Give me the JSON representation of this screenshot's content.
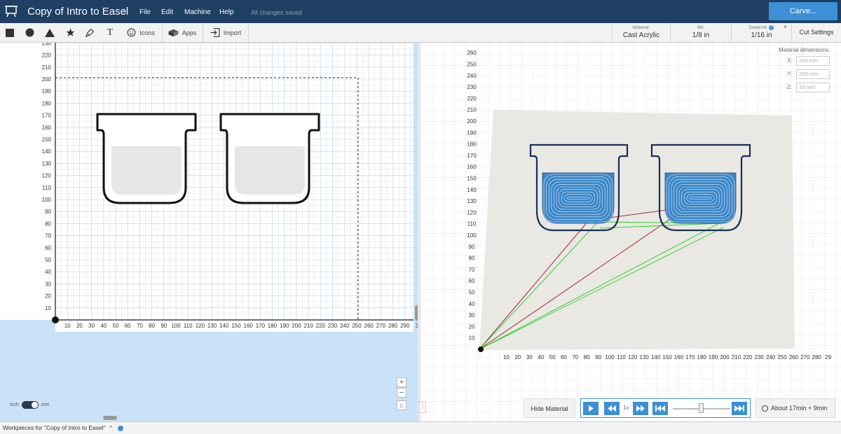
{
  "header": {
    "title": "Copy of Intro to Easel",
    "menu": [
      "File",
      "Edit",
      "Machine",
      "Help"
    ],
    "save_status": "All changes saved",
    "carve_label": "Carve..."
  },
  "toolbar": {
    "shape_tools": [
      "square-icon",
      "circle-icon",
      "triangle-icon",
      "star-icon",
      "pen-icon",
      "text-icon"
    ],
    "icons_label": "Icons",
    "apps_label": "Apps",
    "import_label": "Import",
    "material_caption": "Material:",
    "material_value": "Cast Acrylic",
    "bit_caption": "Bit:",
    "bit_value": "1/8 in",
    "detail_bit_caption": "Detail bit:",
    "detail_bit_value": "1/16 in",
    "cut_settings_label": "Cut Settings"
  },
  "design_canvas": {
    "y_ticks": [
      "10",
      "20",
      "30",
      "40",
      "50",
      "60",
      "70",
      "80",
      "90",
      "100",
      "110",
      "120",
      "130",
      "140",
      "150",
      "160",
      "170",
      "180",
      "190",
      "200",
      "210",
      "220",
      "230"
    ],
    "x_ticks": [
      "10",
      "20",
      "30",
      "40",
      "50",
      "60",
      "70",
      "80",
      "90",
      "100",
      "110",
      "120",
      "130",
      "140",
      "150",
      "160",
      "170",
      "180",
      "190",
      "200",
      "210",
      "220",
      "230",
      "240",
      "250",
      "260",
      "270",
      "280",
      "290",
      "3"
    ],
    "unit_inch": "inch",
    "unit_mm": "mm",
    "unit_selected": "mm",
    "zoom_in": "+",
    "zoom_out": "−"
  },
  "preview": {
    "y_ticks": [
      "10",
      "20",
      "30",
      "40",
      "50",
      "60",
      "70",
      "80",
      "90",
      "100",
      "110",
      "120",
      "130",
      "140",
      "150",
      "160",
      "170",
      "180",
      "190",
      "200",
      "210",
      "220",
      "230",
      "240",
      "250",
      "260"
    ],
    "x_ticks": [
      "10",
      "20",
      "30",
      "40",
      "50",
      "60",
      "70",
      "80",
      "90",
      "100",
      "110",
      "120",
      "130",
      "140",
      "150",
      "160",
      "170",
      "180",
      "190",
      "200",
      "210",
      "220",
      "230",
      "240",
      "250",
      "260",
      "270",
      "280",
      "29"
    ],
    "material_dimensions_label": "Material dimensions:",
    "dims": [
      {
        "axis": "X:",
        "value": "250 mm"
      },
      {
        "axis": "Y:",
        "value": "200 mm"
      },
      {
        "axis": "Z:",
        "value": "10 mm"
      }
    ],
    "close_label": "×"
  },
  "playback": {
    "hide_material_label": "Hide Material",
    "speed_label": "1x",
    "time_estimate": "About 17min + 9min",
    "menu_dots": "⋮"
  },
  "colors": {
    "header_bg": "#1f3f63",
    "accent": "#3d8fd6",
    "canvas_bg": "#c9e2f7",
    "toolpath_fill": "#3a86c8",
    "rapid_red": "#a0283c",
    "rapid_green": "#33cc33"
  },
  "status_bar": {
    "text": "Workpieces for \"Copy of Intro to Easel\"",
    "caret": "^"
  }
}
